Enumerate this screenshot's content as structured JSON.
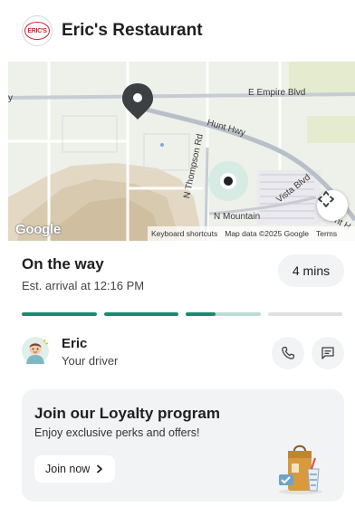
{
  "header": {
    "logo_text": "ERIC'S",
    "title": "Eric's Restaurant"
  },
  "map": {
    "labels": {
      "road_empire": "E Empire Blvd",
      "road_hunt": "Hunt Hwy",
      "road_thompson": "N Thompson Rd",
      "road_vista": "Vista Blvd",
      "road_mountain": "N Mountain",
      "road_edge_left": "y",
      "road_edge_right": "nt H"
    },
    "google_logo": "Google",
    "attribution": {
      "shortcuts": "Keyboard shortcuts",
      "data": "Map data ©2025 Google",
      "terms": "Terms"
    },
    "icons": {
      "restaurant_marker": "map-pin-icon",
      "driver_marker": "location-dot-icon",
      "recenter": "recenter-icon"
    }
  },
  "status": {
    "title": "On the way",
    "arrival": "Est. arrival at 12:16 PM",
    "eta": "4 mins",
    "progress": [
      1,
      1,
      0.4,
      0
    ],
    "accent": "#188a6f"
  },
  "driver": {
    "name": "Eric",
    "role": "Your driver",
    "icons": {
      "call": "phone-icon",
      "message": "message-icon"
    }
  },
  "loyalty": {
    "title": "Join our Loyalty program",
    "subtitle": "Enjoy exclusive perks and offers!",
    "button": "Join now",
    "button_icon": "chevron-right-icon"
  }
}
